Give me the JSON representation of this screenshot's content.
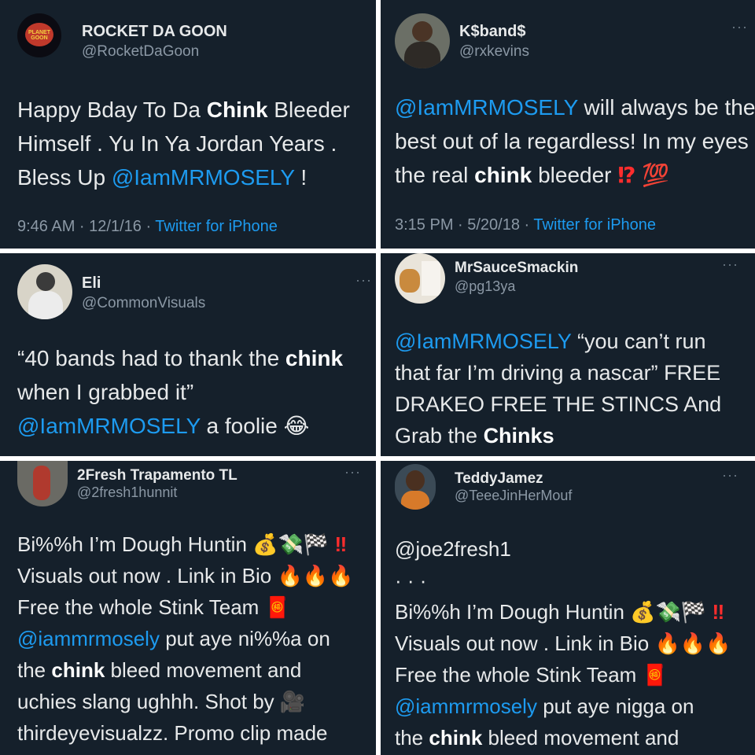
{
  "tweets": [
    {
      "name": "ROCKET DA GOON",
      "handle": "@RocketDaGoon",
      "avatar_text": "PLANET GOON",
      "lines": [
        [
          {
            "t": "Happy Bday To Da "
          },
          {
            "t": "Chink",
            "s": "b"
          },
          {
            "t": " Bleeder"
          }
        ],
        [
          {
            "t": "Himself . Yu In Ya Jordan Years ."
          }
        ],
        [
          {
            "t": "Bless Up "
          },
          {
            "t": "@IamMRMOSELY",
            "s": "m"
          },
          {
            "t": " !"
          }
        ]
      ],
      "time": "9:46 AM · 12/1/16 · ",
      "source": "Twitter for iPhone"
    },
    {
      "name": "K$band$",
      "handle": "@rxkevins",
      "lines": [
        [
          {
            "t": "@IamMRMOSELY",
            "s": "m"
          },
          {
            "t": " will always be the"
          }
        ],
        [
          {
            "t": "best out of la regardless! In my eyes"
          }
        ],
        [
          {
            "t": "the real "
          },
          {
            "t": "chink",
            "s": "b"
          },
          {
            "t": " bleeder "
          },
          {
            "t": "⁉",
            "s": "red"
          },
          {
            "t": " 💯"
          }
        ]
      ],
      "time": "3:15 PM · 5/20/18 · ",
      "source": "Twitter for iPhone"
    },
    {
      "name": "Eli",
      "handle": "@CommonVisuals",
      "lines": [
        [
          {
            "t": "“40 bands had to thank the "
          },
          {
            "t": "chink",
            "s": "b"
          }
        ],
        [
          {
            "t": "when I grabbed it”"
          }
        ],
        [
          {
            "t": "@IamMRMOSELY",
            "s": "m"
          },
          {
            "t": " a foolie 😂"
          }
        ]
      ]
    },
    {
      "name": "MrSauceSmackin",
      "handle": "@pg13ya",
      "lines": [
        [
          {
            "t": "@IamMRMOSELY",
            "s": "m"
          },
          {
            "t": " “you can’t run"
          }
        ],
        [
          {
            "t": "that far I’m driving a nascar” FREE"
          }
        ],
        [
          {
            "t": "DRAKEO FREE THE STINCS And"
          }
        ],
        [
          {
            "t": "Grab the "
          },
          {
            "t": "Chinks",
            "s": "b"
          }
        ]
      ]
    },
    {
      "name": "2Fresh Trapamento TL",
      "handle": "@2fresh1hunnit",
      "lines": [
        [
          {
            "t": "Bi%%h I’m Dough Huntin 💰💸🏁 "
          },
          {
            "t": "‼",
            "s": "red"
          }
        ],
        [
          {
            "t": "Visuals out now . Link in Bio 🔥🔥🔥"
          }
        ],
        [
          {
            "t": "Free the whole Stink Team 🧧"
          }
        ],
        [
          {
            "t": "@iammrmosely",
            "s": "m"
          },
          {
            "t": " put aye ni%%a on"
          }
        ],
        [
          {
            "t": "the "
          },
          {
            "t": "chink",
            "s": "b"
          },
          {
            "t": " bleed  movement and"
          }
        ],
        [
          {
            "t": "uchies slang ughhh. Shot by 🎥"
          }
        ],
        [
          {
            "t": "thirdeyevisualzz. Promo clip made"
          }
        ]
      ]
    },
    {
      "name": "TeddyJamez",
      "handle": "@TeeeJinHerMouf",
      "lines": [
        [
          {
            "t": "@joe2fresh1"
          }
        ],
        [
          {
            "t": "  ·   ·   ·"
          }
        ],
        [
          {
            "t": "Bi%%h I’m Dough Huntin 💰💸🏁 "
          },
          {
            "t": "‼",
            "s": "red"
          }
        ],
        [
          {
            "t": "Visuals out now . Link in Bio 🔥🔥🔥"
          }
        ],
        [
          {
            "t": "Free the whole Stink Team 🧧"
          }
        ],
        [
          {
            "t": "@iammrmosely",
            "s": "m"
          },
          {
            "t": " put aye nigga on"
          }
        ],
        [
          {
            "t": "the "
          },
          {
            "t": "chink",
            "s": "b"
          },
          {
            "t": " bleed  movement and"
          }
        ]
      ]
    }
  ],
  "more_glyph": "···",
  "colors": {
    "bg": "#15202b",
    "mention": "#1d9bf0",
    "text": "#e7e9ea",
    "muted": "#8b98a5"
  }
}
